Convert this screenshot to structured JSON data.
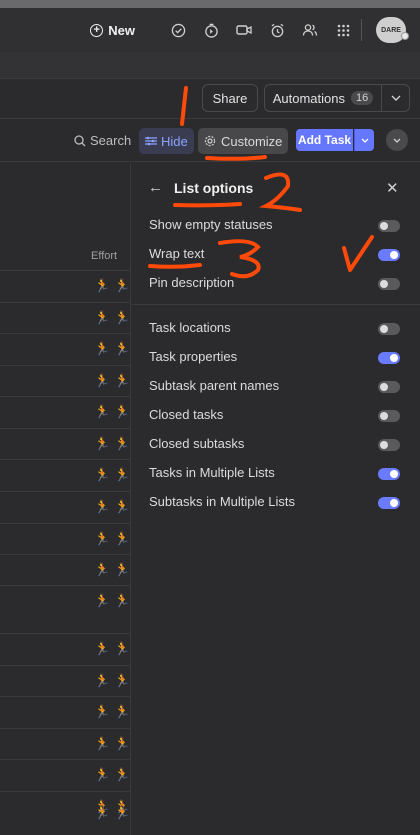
{
  "topbar": {
    "new_label": "New",
    "avatar_text": "DARE",
    "icons": [
      "check-circle-icon",
      "timer-icon",
      "video-icon",
      "alarm-icon",
      "people-icon",
      "apps-grid-icon"
    ]
  },
  "header": {
    "share_label": "Share",
    "automations_label": "Automations",
    "automations_count": "16"
  },
  "toolbar": {
    "search_label": "Search",
    "hide_label": "Hide",
    "customize_label": "Customize",
    "add_task_label": "Add Task"
  },
  "table": {
    "column_header": "Effort",
    "runner_glyph": "🏃"
  },
  "panel": {
    "title": "List options",
    "options_group1": [
      {
        "label": "Show empty statuses",
        "on": false
      },
      {
        "label": "Wrap text",
        "on": true
      },
      {
        "label": "Pin description",
        "on": false
      }
    ],
    "options_group2": [
      {
        "label": "Task locations",
        "on": false
      },
      {
        "label": "Task properties",
        "on": true
      },
      {
        "label": "Subtask parent names",
        "on": false
      },
      {
        "label": "Closed tasks",
        "on": false
      },
      {
        "label": "Closed subtasks",
        "on": false
      },
      {
        "label": "Tasks in Multiple Lists",
        "on": true
      },
      {
        "label": "Subtasks in Multiple Lists",
        "on": true
      }
    ]
  },
  "annotations": {
    "mark1": "1",
    "mark2": "2",
    "mark3": "3",
    "color": "#ff4a0a"
  },
  "colors": {
    "accent": "#6677ff",
    "toggle_on": "#6a7bff",
    "hide_text": "#8ea3ff",
    "background": "#2b2b2d"
  }
}
